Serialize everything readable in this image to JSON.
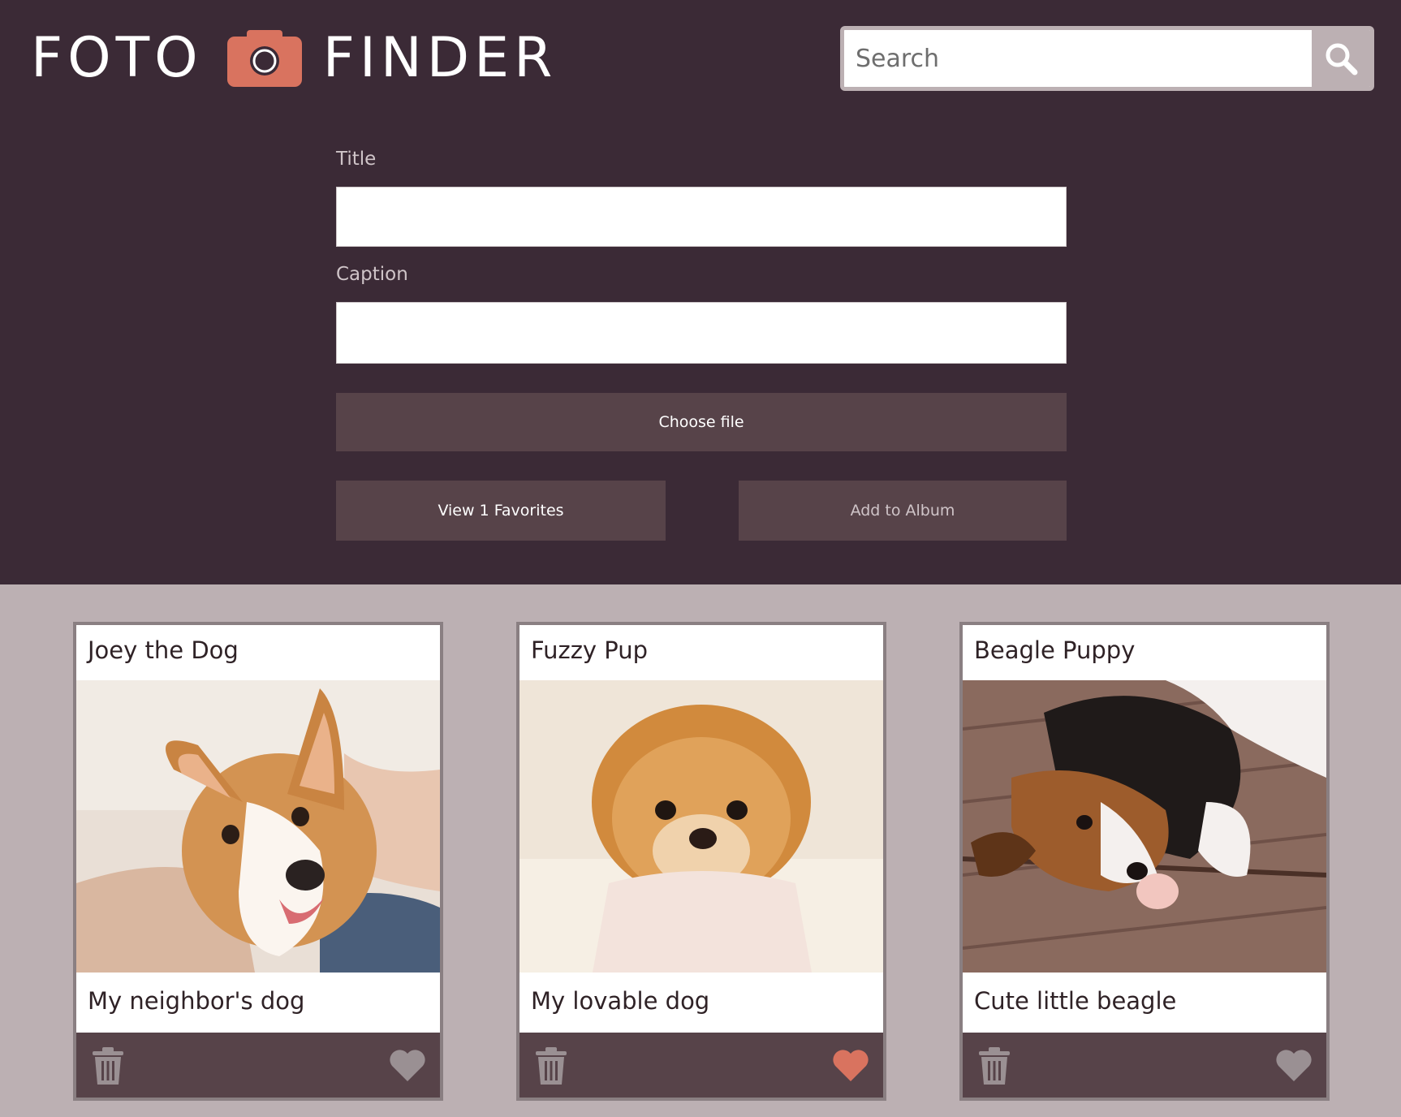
{
  "app": {
    "logo_left": "FOTO",
    "logo_right": "FINDER"
  },
  "search": {
    "placeholder": "Search"
  },
  "form": {
    "title_label": "Title",
    "caption_label": "Caption",
    "choose_file_label": "Choose file",
    "view_favorites_label": "View 1 Favorites",
    "add_album_label": "Add to Album"
  },
  "cards": [
    {
      "title": "Joey the Dog",
      "caption": "My neighbor's dog",
      "favorite": false
    },
    {
      "title": "Fuzzy Pup",
      "caption": "My lovable dog",
      "favorite": true
    },
    {
      "title": "Beagle Puppy",
      "caption": "Cute little beagle",
      "favorite": false
    }
  ],
  "colors": {
    "header_bg": "#3b2a36",
    "page_bg": "#bcb0b3",
    "button_bg": "#574349",
    "accent": "#d9735f",
    "heart_inactive": "#9a9093",
    "trash": "#9a9093"
  }
}
